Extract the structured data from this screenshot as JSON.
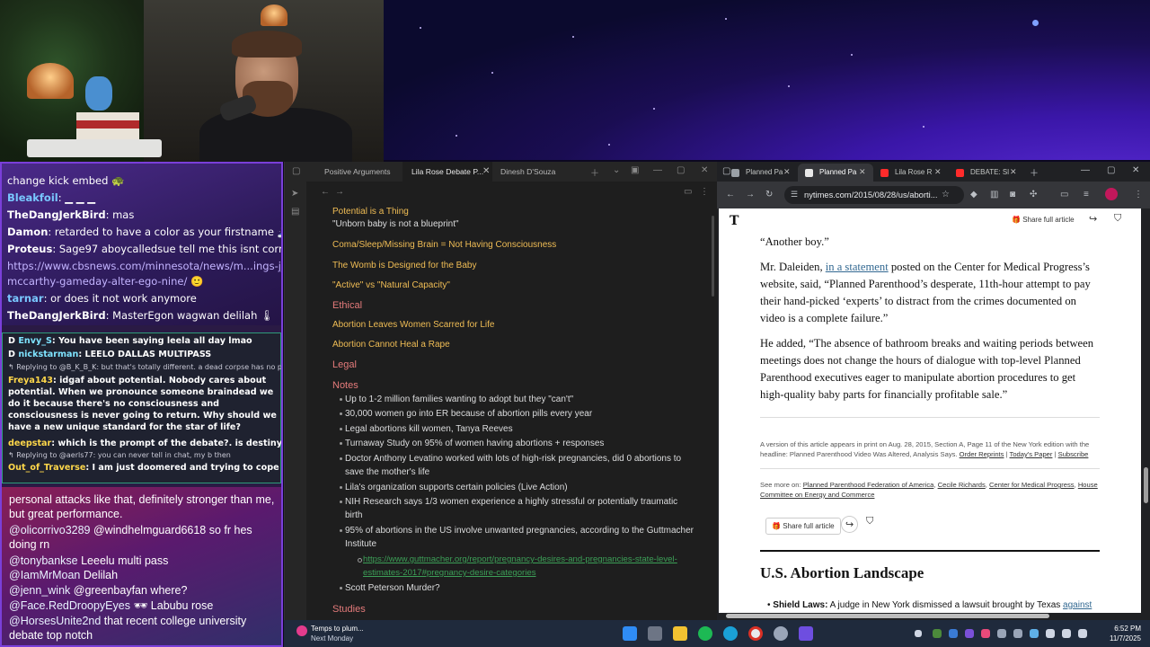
{
  "chat": {
    "top_lines": [
      {
        "user": "",
        "text": "change kick embed 🐢"
      },
      {
        "user": "Bleakfoil",
        "text": ": ▁ ▁ ▁"
      },
      {
        "user": "TheDangJerkBird",
        "text": ": mas"
      },
      {
        "user": "Damon",
        "text": ": retarded to have a color as your firstname 🗻"
      },
      {
        "user": "Proteus",
        "text": ": Sage97 aboycalledsue tell me this isnt corny"
      },
      {
        "user": "",
        "text": "https://www.cbsnews.com/minnesota/news/m...ings-jj-"
      },
      {
        "user": "",
        "text": "mccarthy-gameday-alter-ego-nine/ 🙂"
      },
      {
        "user": "tarnar",
        "text": ": or does it not work anymore"
      },
      {
        "user": "TheDangJerkBird",
        "text": ": MasterEgon wagwan delilah 🌡"
      }
    ],
    "mid_lines": [
      {
        "user": "Envy_S",
        "text": ": You have been saying leela all day lmao"
      },
      {
        "user": "nickstarman",
        "text": ": LEELO DALLAS MULTIPASS"
      },
      {
        "reply": "↰ Replying to @B_K_B_K: but that's totally different. a dead corpse has no po"
      },
      {
        "user": "Freya143",
        "text": ": idgaf about potential. Nobody cares about potential. When we pronounce someone braindead we do it because there's no consciousness and consciousness is never going to return. Why should we have a new unique standard for the star of life?"
      },
      {
        "user": "deepstar",
        "text": ": which is the prompt of the debate?. is destiny sterile?"
      },
      {
        "reply": "↰ Replying to @aerls77: you can never tell in chat, my b then"
      },
      {
        "user": "Out_of_Traverse",
        "text": ": I am just doomered and trying to cope"
      }
    ],
    "bottom_lines": [
      {
        "user": "",
        "text": "personal attacks like that, definitely stronger than me, but great performance."
      },
      {
        "user": "@olicorrivo3289",
        "text": " @windhelmguard6618 so fr hes doing rn"
      },
      {
        "user": "@tonybankse",
        "text": " Leeelu multi pass"
      },
      {
        "user": "@IamMrMoan",
        "text": " Delilah"
      },
      {
        "user": "@jenn_wink",
        "text": " @greenbayfan where?"
      },
      {
        "user": "@Face.RedDroopyEyes",
        "text": " 🕶 Labubu rose"
      },
      {
        "user": "@HorsesUnite2nd",
        "text": " that recent college university debate top notch"
      }
    ]
  },
  "notes": {
    "tabs": [
      "Positive Arguments",
      "Lila Rose Debate P...",
      "Dinesh D'Souza"
    ],
    "items": [
      {
        "kind": "h",
        "text": "Potential is a Thing"
      },
      {
        "kind": "q",
        "text": "\"Unborn baby is not a blueprint\""
      },
      {
        "kind": "h",
        "text": "Coma/Sleep/Missing Brain = Not Having Consciousness"
      },
      {
        "kind": "h",
        "text": "The Womb is Designed for the Baby"
      },
      {
        "kind": "h",
        "text": "\"Active\" vs \"Natural Capacity\""
      },
      {
        "kind": "h2",
        "text": "Ethical"
      },
      {
        "kind": "h",
        "text": "Abortion Leaves Women Scarred for Life"
      },
      {
        "kind": "h",
        "text": "Abortion Cannot Heal a Rape"
      },
      {
        "kind": "h2",
        "text": "Legal"
      },
      {
        "kind": "h2",
        "text": "Notes"
      }
    ],
    "bullets": [
      "Up to 1-2 million families wanting to adopt but they \"can't\"",
      "30,000 women go into ER because of abortion pills every year",
      "Legal abortions kill women, Tanya Reeves",
      "Turnaway Study on 95% of women having abortions + responses",
      "Doctor Anthony Levatino worked with lots of high-risk pregnancies, did 0 abortions to save the mother's life",
      "Lila's organization supports certain policies (Live Action)",
      "NIH Research says 1/3 women experience a highly stressful or potentially traumatic birth",
      "95% of abortions in the US involve unwanted pregnancies, according to the Guttmacher Institute"
    ],
    "link": "https://www.guttmacher.org/report/pregnancy-desires-and-pregnancies-state-level-estimates-2017#pregnancy-desire-categories",
    "last_bullet": "Scott Peterson Murder?",
    "studies": "Studies"
  },
  "browser": {
    "tabs": [
      "Planned Pa",
      "Planned Pa",
      "Lila Rose R",
      "DEBATE: Sl"
    ],
    "url": "nytimes.com/2015/08/28/us/aborti...",
    "logo": "T",
    "share_label": "Share full article",
    "p1": "“Another boy.”",
    "p2_pre": "Mr. Daleiden, ",
    "p2_link": "in a statement",
    "p2_post": " posted on the Center for Medical Progress’s website, said, “Planned Parenthood’s desperate, 11th-hour attempt to pay their hand-picked ‘experts’ to distract from the crimes documented on video is a complete failure.”",
    "p3": "He added, “The absence of bathroom breaks and waiting periods between meetings does not change the hours of dialogue with top-level Planned Parenthood executives eager to manipulate abortion procedures to get high-quality baby parts for financially profitable sale.”",
    "print_note": "A version of this article appears in print on Aug. 28, 2015, Section A, Page 11 of the New York edition with the headline: Planned Parenthood Video Was Altered, Analysis Says.",
    "order_reprints": "Order Reprints",
    "todays_paper": "Today's Paper",
    "subscribe": "Subscribe",
    "see_more_label": "See more on:",
    "see_more": [
      "Planned Parenthood Federation of America",
      "Cecile Richards",
      "Center for Medical Progress",
      "House Committee on Energy and Commerce"
    ],
    "section_title": "U.S. Abortion Landscape",
    "li_bold": "Shield Laws:",
    "li_text": " A judge in New York dismissed a lawsuit brought by Texas ",
    "li_link": "against"
  },
  "taskbar": {
    "notif_title": "Temps to plum...",
    "notif_sub": "Next Monday",
    "time": "6:52 PM",
    "date": "11/7/2025"
  }
}
